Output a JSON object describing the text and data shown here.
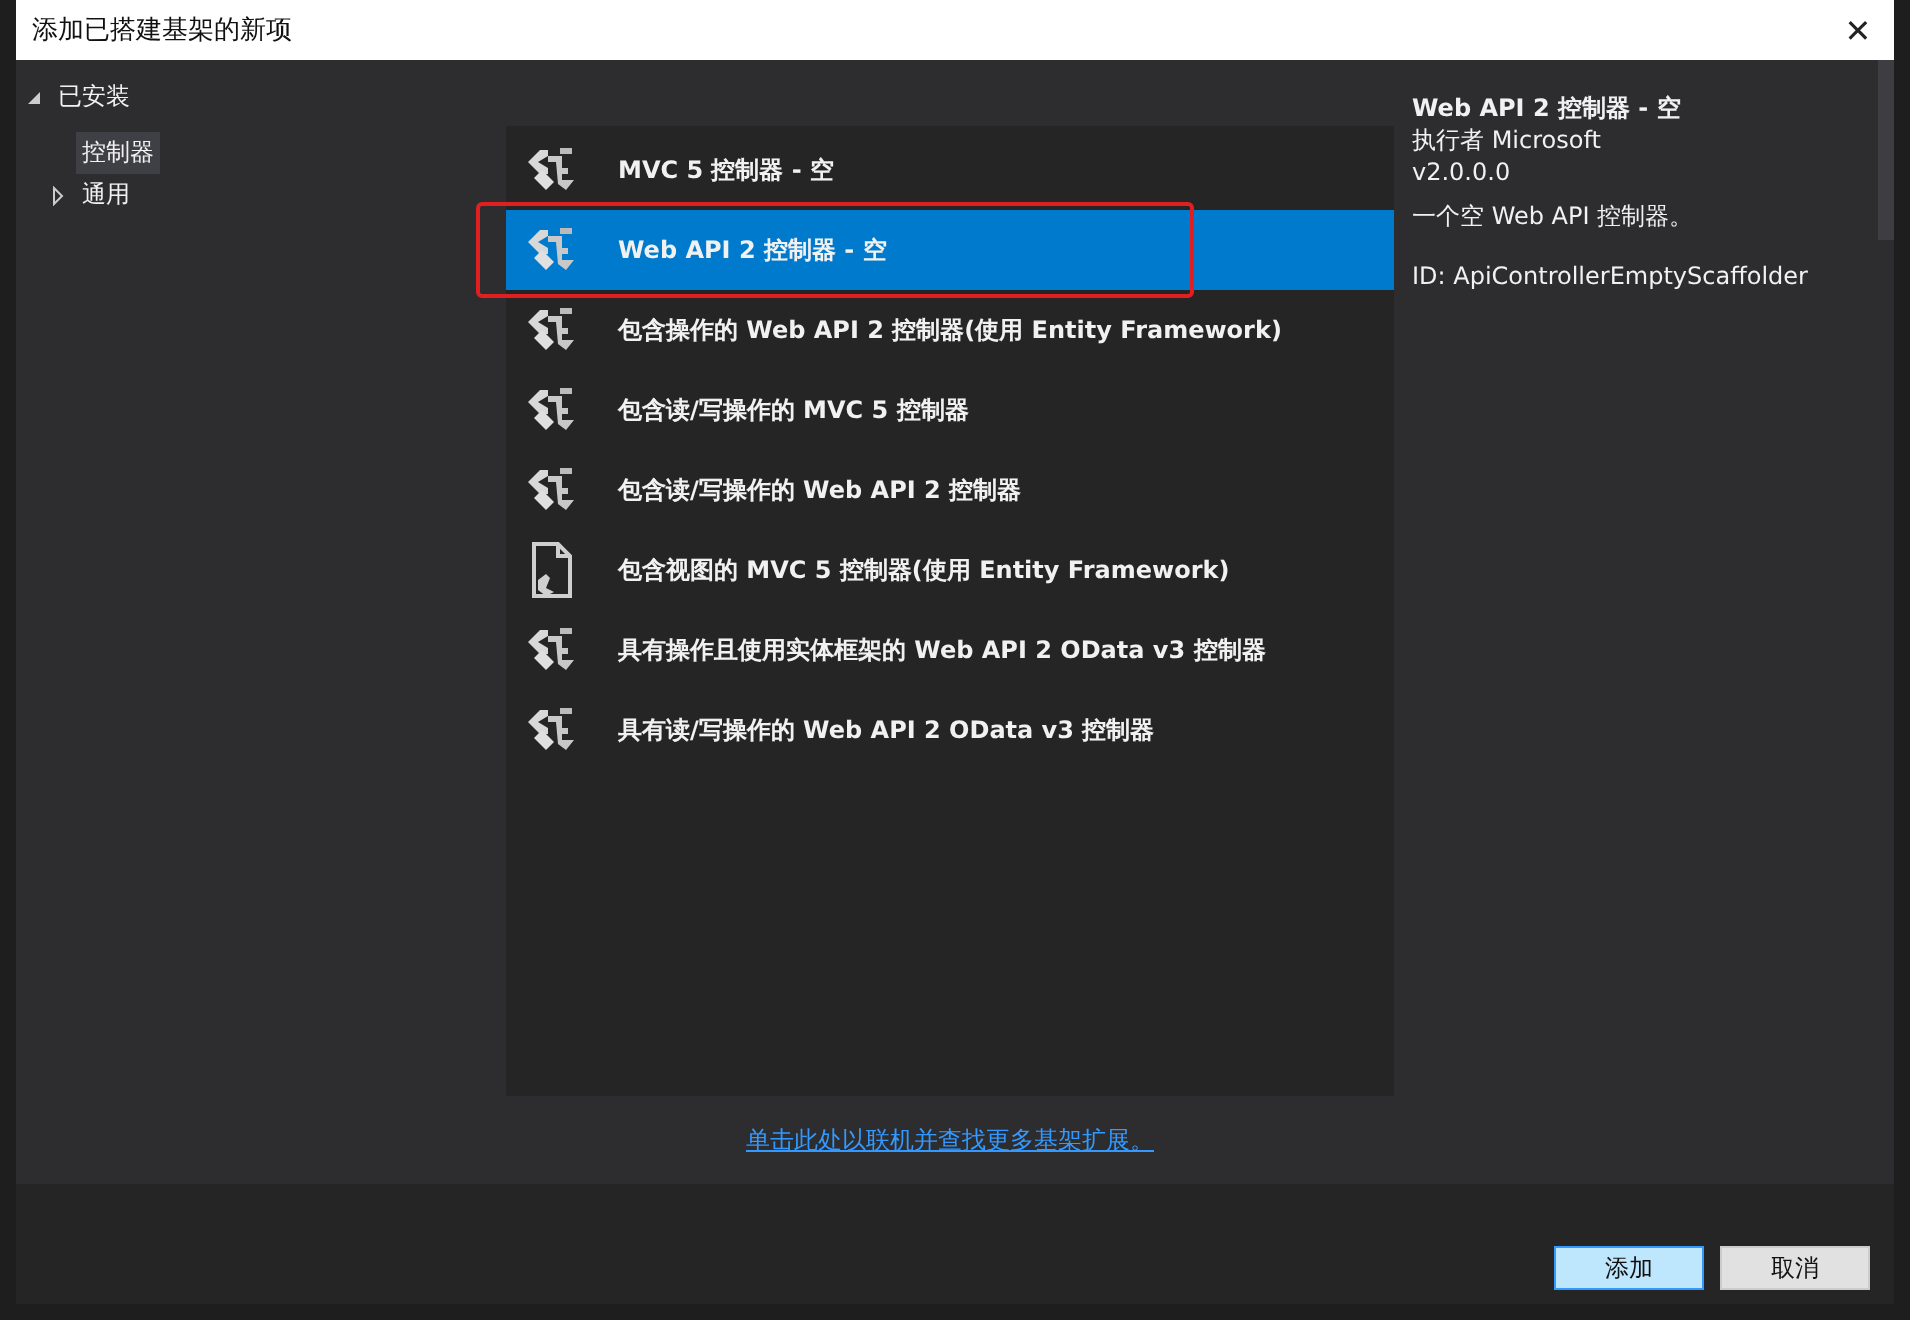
{
  "window": {
    "title": "添加已搭建基架的新项",
    "close": "✕"
  },
  "tree": [
    {
      "label": "已安装",
      "expanded": true,
      "selected": false,
      "children": [
        {
          "label": "控制器",
          "selected": true,
          "expanded": false,
          "has_children": false
        },
        {
          "label": "通用",
          "selected": false,
          "expanded": false,
          "has_children": true
        }
      ]
    }
  ],
  "templates": [
    {
      "label": "MVC 5 控制器 - 空",
      "kind": "controller",
      "selected": false,
      "annotated": false
    },
    {
      "label": "Web API 2 控制器 - 空",
      "kind": "controller",
      "selected": true,
      "annotated": true
    },
    {
      "label": "包含操作的 Web API 2 控制器(使用 Entity Framework)",
      "kind": "controller",
      "selected": false,
      "annotated": false
    },
    {
      "label": "包含读/写操作的 MVC 5 控制器",
      "kind": "controller",
      "selected": false,
      "annotated": false
    },
    {
      "label": "包含读/写操作的 Web API 2 控制器",
      "kind": "controller",
      "selected": false,
      "annotated": false
    },
    {
      "label": "包含视图的 MVC 5 控制器(使用 Entity Framework)",
      "kind": "view",
      "selected": false,
      "annotated": false
    },
    {
      "label": "具有操作且使用实体框架的 Web API 2 OData v3 控制器",
      "kind": "controller",
      "selected": false,
      "annotated": false
    },
    {
      "label": "具有读/写操作的 Web API 2 OData v3 控制器",
      "kind": "controller",
      "selected": false,
      "annotated": false
    }
  ],
  "details": {
    "title": "Web API 2 控制器 - 空",
    "author": "执行者 Microsoft",
    "version": "v2.0.0.0",
    "description": "一个空 Web API 控制器。",
    "id": "ID: ApiControllerEmptyScaffolder"
  },
  "online_link": "单击此处以联机并查找更多基架扩展。",
  "buttons": [
    {
      "label": "添加",
      "kind": "primary"
    },
    {
      "label": "取消",
      "kind": "secondary"
    }
  ]
}
